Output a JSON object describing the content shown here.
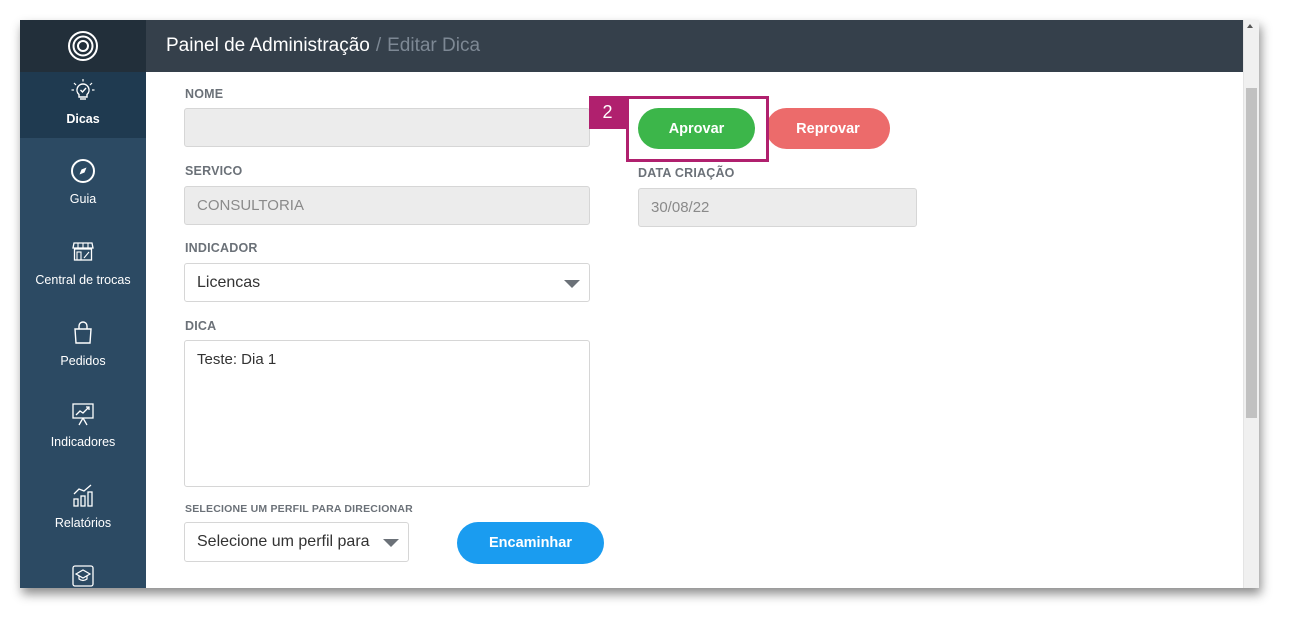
{
  "header": {
    "title": "Painel de Administração",
    "separator": "/",
    "subtitle": "Editar Dica"
  },
  "sidebar": {
    "items": [
      {
        "label": "Dicas",
        "icon": "lightbulb-icon",
        "active": true
      },
      {
        "label": "Guia",
        "icon": "compass-icon",
        "active": false
      },
      {
        "label": "Central de trocas",
        "icon": "storefront-icon",
        "active": false
      },
      {
        "label": "Pedidos",
        "icon": "shopping-bag-icon",
        "active": false
      },
      {
        "label": "Indicadores",
        "icon": "presentation-chart-icon",
        "active": false
      },
      {
        "label": "Relatórios",
        "icon": "bar-chart-icon",
        "active": false
      },
      {
        "label": "",
        "icon": "graduation-cap-icon",
        "active": false
      }
    ]
  },
  "form": {
    "nome_label": "NOME",
    "nome_value": "",
    "servico_label": "SERVICO",
    "servico_value": "CONSULTORIA",
    "indicador_label": "INDICADOR",
    "indicador_value": "Licencas",
    "dica_label": "DICA",
    "dica_value": "Teste: Dia 1",
    "perfil_label": "SELECIONE UM PERFIL PARA DIRECIONAR",
    "perfil_value": "Selecione um perfil para",
    "data_label": "DATA CRIAÇÃO",
    "data_value": "30/08/22"
  },
  "buttons": {
    "approve": "Aprovar",
    "reject": "Reprovar",
    "forward": "Encaminhar"
  },
  "annotation": {
    "step_number": "2",
    "color": "#b0206e"
  },
  "colors": {
    "sidebar": "#2c4a63",
    "header": "#35404b",
    "approve": "#3cb64a",
    "reject": "#ec6b6b",
    "forward": "#1a9cf0"
  }
}
